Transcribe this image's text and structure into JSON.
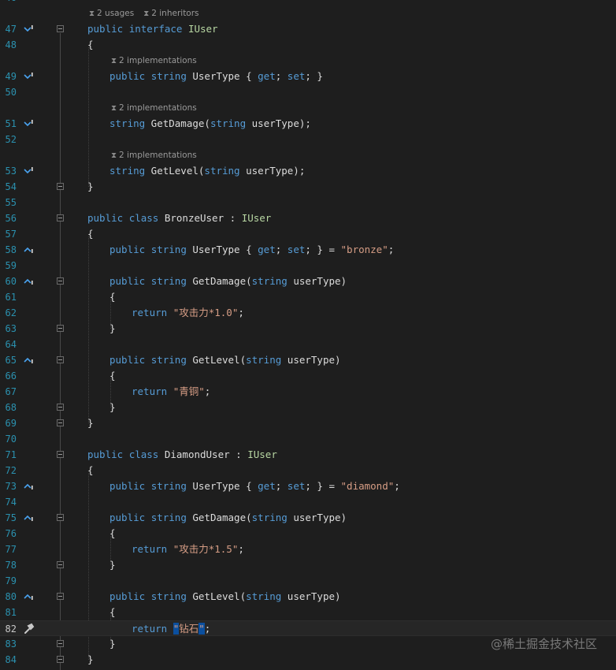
{
  "top_line_fragment": "46",
  "codelens": [
    {
      "line": 47,
      "indent": 1,
      "items": [
        "2 usages",
        "2 inheritors"
      ]
    },
    {
      "line": 49,
      "indent": 2,
      "items": [
        "2 implementations"
      ]
    },
    {
      "line": 51,
      "indent": 2,
      "items": [
        "2 implementations"
      ]
    },
    {
      "line": 53,
      "indent": 2,
      "items": [
        "2 implementations"
      ]
    }
  ],
  "lines": [
    {
      "n": 47,
      "indent": 1,
      "marker": "impl-down",
      "fold": true,
      "tokens": [
        [
          "kw",
          "public"
        ],
        [
          "t",
          " "
        ],
        [
          "kw",
          "interface"
        ],
        [
          "t",
          " "
        ],
        [
          "ty",
          "IUser"
        ]
      ]
    },
    {
      "n": 48,
      "indent": 1,
      "tokens": [
        [
          "t",
          "{"
        ]
      ]
    },
    {
      "n": 49,
      "indent": 2,
      "marker": "impl-down",
      "tokens": [
        [
          "kw",
          "public"
        ],
        [
          "t",
          " "
        ],
        [
          "kw",
          "string"
        ],
        [
          "t",
          " UserType { "
        ],
        [
          "kw",
          "get"
        ],
        [
          "t",
          "; "
        ],
        [
          "kw",
          "set"
        ],
        [
          "t",
          "; }"
        ]
      ]
    },
    {
      "n": 50,
      "indent": 2,
      "tokens": []
    },
    {
      "n": 51,
      "indent": 2,
      "marker": "impl-down",
      "tokens": [
        [
          "kw",
          "string"
        ],
        [
          "t",
          " GetDamage("
        ],
        [
          "kw",
          "string"
        ],
        [
          "t",
          " userType);"
        ]
      ]
    },
    {
      "n": 52,
      "indent": 2,
      "tokens": []
    },
    {
      "n": 53,
      "indent": 2,
      "marker": "impl-down",
      "tokens": [
        [
          "kw",
          "string"
        ],
        [
          "t",
          " GetLevel("
        ],
        [
          "kw",
          "string"
        ],
        [
          "t",
          " userType);"
        ]
      ]
    },
    {
      "n": 54,
      "indent": 1,
      "fold": true,
      "tokens": [
        [
          "t",
          "}"
        ]
      ]
    },
    {
      "n": 55,
      "indent": 1,
      "tokens": []
    },
    {
      "n": 56,
      "indent": 1,
      "fold": true,
      "tokens": [
        [
          "kw",
          "public"
        ],
        [
          "t",
          " "
        ],
        [
          "kw",
          "class"
        ],
        [
          "t",
          " BronzeUser : "
        ],
        [
          "ty",
          "IUser"
        ]
      ]
    },
    {
      "n": 57,
      "indent": 1,
      "tokens": [
        [
          "t",
          "{"
        ]
      ]
    },
    {
      "n": 58,
      "indent": 2,
      "marker": "impl-up",
      "tokens": [
        [
          "kw",
          "public"
        ],
        [
          "t",
          " "
        ],
        [
          "kw",
          "string"
        ],
        [
          "t",
          " UserType { "
        ],
        [
          "kw",
          "get"
        ],
        [
          "t",
          "; "
        ],
        [
          "kw",
          "set"
        ],
        [
          "t",
          "; } = "
        ],
        [
          "str",
          "\"bronze\""
        ],
        [
          "t",
          ";"
        ]
      ]
    },
    {
      "n": 59,
      "indent": 2,
      "tokens": []
    },
    {
      "n": 60,
      "indent": 2,
      "marker": "impl-up",
      "fold": true,
      "tokens": [
        [
          "kw",
          "public"
        ],
        [
          "t",
          " "
        ],
        [
          "kw",
          "string"
        ],
        [
          "t",
          " GetDamage("
        ],
        [
          "kw",
          "string"
        ],
        [
          "t",
          " userType)"
        ]
      ]
    },
    {
      "n": 61,
      "indent": 2,
      "tokens": [
        [
          "t",
          "{"
        ]
      ]
    },
    {
      "n": 62,
      "indent": 3,
      "tokens": [
        [
          "kw",
          "return"
        ],
        [
          "t",
          " "
        ],
        [
          "str",
          "\"攻击力*1.0\""
        ],
        [
          "t",
          ";"
        ]
      ]
    },
    {
      "n": 63,
      "indent": 2,
      "fold": true,
      "tokens": [
        [
          "t",
          "}"
        ]
      ]
    },
    {
      "n": 64,
      "indent": 2,
      "tokens": []
    },
    {
      "n": 65,
      "indent": 2,
      "marker": "impl-up",
      "fold": true,
      "tokens": [
        [
          "kw",
          "public"
        ],
        [
          "t",
          " "
        ],
        [
          "kw",
          "string"
        ],
        [
          "t",
          " GetLevel("
        ],
        [
          "kw",
          "string"
        ],
        [
          "t",
          " userType)"
        ]
      ]
    },
    {
      "n": 66,
      "indent": 2,
      "tokens": [
        [
          "t",
          "{"
        ]
      ]
    },
    {
      "n": 67,
      "indent": 3,
      "tokens": [
        [
          "kw",
          "return"
        ],
        [
          "t",
          " "
        ],
        [
          "str",
          "\"青铜\""
        ],
        [
          "t",
          ";"
        ]
      ]
    },
    {
      "n": 68,
      "indent": 2,
      "fold": true,
      "tokens": [
        [
          "t",
          "}"
        ]
      ]
    },
    {
      "n": 69,
      "indent": 1,
      "fold": true,
      "tokens": [
        [
          "t",
          "}"
        ]
      ]
    },
    {
      "n": 70,
      "indent": 1,
      "tokens": []
    },
    {
      "n": 71,
      "indent": 1,
      "fold": true,
      "tokens": [
        [
          "kw",
          "public"
        ],
        [
          "t",
          " "
        ],
        [
          "kw",
          "class"
        ],
        [
          "t",
          " DiamondUser : "
        ],
        [
          "ty",
          "IUser"
        ]
      ]
    },
    {
      "n": 72,
      "indent": 1,
      "tokens": [
        [
          "t",
          "{"
        ]
      ]
    },
    {
      "n": 73,
      "indent": 2,
      "marker": "impl-up",
      "tokens": [
        [
          "kw",
          "public"
        ],
        [
          "t",
          " "
        ],
        [
          "kw",
          "string"
        ],
        [
          "t",
          " UserType { "
        ],
        [
          "kw",
          "get"
        ],
        [
          "t",
          "; "
        ],
        [
          "kw",
          "set"
        ],
        [
          "t",
          "; } = "
        ],
        [
          "str",
          "\"diamond\""
        ],
        [
          "t",
          ";"
        ]
      ]
    },
    {
      "n": 74,
      "indent": 2,
      "tokens": []
    },
    {
      "n": 75,
      "indent": 2,
      "marker": "impl-up",
      "fold": true,
      "tokens": [
        [
          "kw",
          "public"
        ],
        [
          "t",
          " "
        ],
        [
          "kw",
          "string"
        ],
        [
          "t",
          " GetDamage("
        ],
        [
          "kw",
          "string"
        ],
        [
          "t",
          " userType)"
        ]
      ]
    },
    {
      "n": 76,
      "indent": 2,
      "tokens": [
        [
          "t",
          "{"
        ]
      ]
    },
    {
      "n": 77,
      "indent": 3,
      "tokens": [
        [
          "kw",
          "return"
        ],
        [
          "t",
          " "
        ],
        [
          "str",
          "\"攻击力*1.5\""
        ],
        [
          "t",
          ";"
        ]
      ]
    },
    {
      "n": 78,
      "indent": 2,
      "fold": true,
      "tokens": [
        [
          "t",
          "}"
        ]
      ]
    },
    {
      "n": 79,
      "indent": 2,
      "tokens": []
    },
    {
      "n": 80,
      "indent": 2,
      "marker": "impl-up",
      "fold": true,
      "tokens": [
        [
          "kw",
          "public"
        ],
        [
          "t",
          " "
        ],
        [
          "kw",
          "string"
        ],
        [
          "t",
          " GetLevel("
        ],
        [
          "kw",
          "string"
        ],
        [
          "t",
          " userType)"
        ]
      ]
    },
    {
      "n": 81,
      "indent": 2,
      "tokens": [
        [
          "t",
          "{"
        ]
      ]
    },
    {
      "n": 82,
      "indent": 3,
      "marker": "quick-action",
      "current": true,
      "tokens": [
        [
          "kw",
          "return"
        ],
        [
          "t",
          " "
        ],
        [
          "hl",
          "\""
        ],
        [
          "str",
          "钻石"
        ],
        [
          "hl",
          "\""
        ],
        [
          "t",
          ";"
        ]
      ]
    },
    {
      "n": 83,
      "indent": 2,
      "fold": true,
      "tokens": [
        [
          "t",
          "}"
        ]
      ]
    },
    {
      "n": 84,
      "indent": 1,
      "fold": true,
      "tokens": [
        [
          "t",
          "}"
        ]
      ]
    }
  ],
  "watermark": "@稀土掘金技术社区",
  "colors": {
    "background": "#1e1e1e",
    "line_number": "#2b91af",
    "keyword": "#569cd6",
    "type": "#b8d7a3",
    "string": "#d69d85",
    "text": "#dcdcdc",
    "codelens": "#9a9a9a",
    "brace_highlight": "#0b4f9e"
  },
  "icons": {
    "impl-down": "implemented-by-arrow-down-icon",
    "impl-up": "implements-arrow-up-icon",
    "quick-action": "wrench-icon",
    "codelens": "hourglass-icon"
  }
}
